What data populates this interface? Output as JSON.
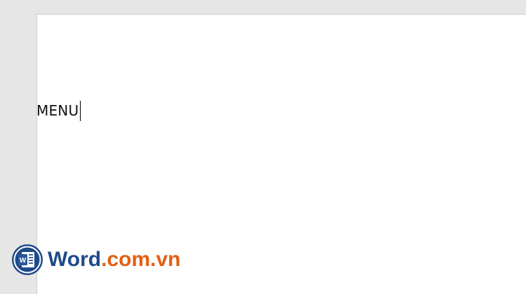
{
  "document": {
    "text": "MENU"
  },
  "logo": {
    "icon_letter": "W",
    "brand_word": "Word",
    "brand_domain": ".com.vn",
    "colors": {
      "blue": "#1f4a8a",
      "orange": "#e35f12"
    },
    "icon": "word-logo-icon"
  }
}
